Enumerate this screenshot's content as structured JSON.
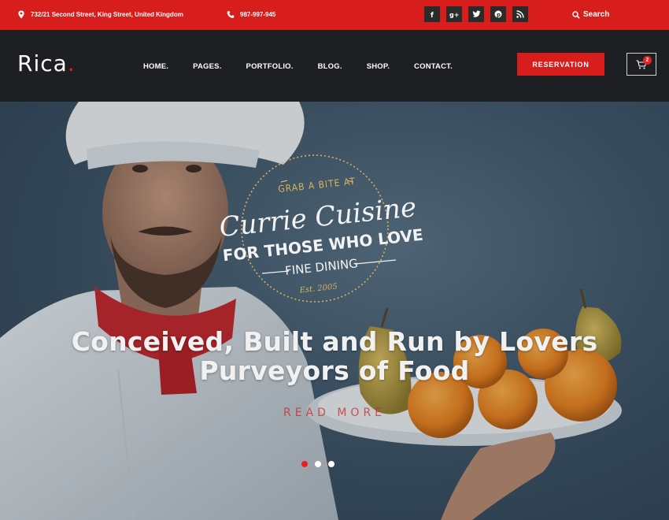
{
  "topbar": {
    "address": "732/21 Second Street, King Street, United Kingdom",
    "phone": "987-997-945",
    "social": [
      {
        "icon": "facebook-icon",
        "glyph": "f"
      },
      {
        "icon": "google-plus-icon",
        "glyph": "g+"
      },
      {
        "icon": "twitter-icon",
        "glyph": "t"
      },
      {
        "icon": "pinterest-icon",
        "glyph": "p"
      },
      {
        "icon": "rss-icon",
        "glyph": "rss"
      }
    ],
    "search_label": "Search"
  },
  "header": {
    "logo": "Rica",
    "logo_dot": ".",
    "nav": [
      "HOME.",
      "PAGES.",
      "PORTFOLIO.",
      "BLOG.",
      "SHOP.",
      "CONTACT."
    ],
    "reservation_label": "RESERVATION",
    "cart_count": "2"
  },
  "hero": {
    "badge": {
      "top": "GRAB A BITE AT",
      "script": "Currie Cuisine",
      "line1": "FOR THOSE WHO LOVE",
      "line2": "FINE DINING",
      "est": "Est. 2005"
    },
    "headline_line1": "Conceived, Built and Run by Lovers",
    "headline_line2": "Purveyors of Food",
    "read_more": "READ MORE",
    "slides": 3,
    "active_slide": 1
  },
  "colors": {
    "accent": "#d81d1d",
    "header_bg": "#1e1f22",
    "badge_gold": "#d9b25a"
  }
}
